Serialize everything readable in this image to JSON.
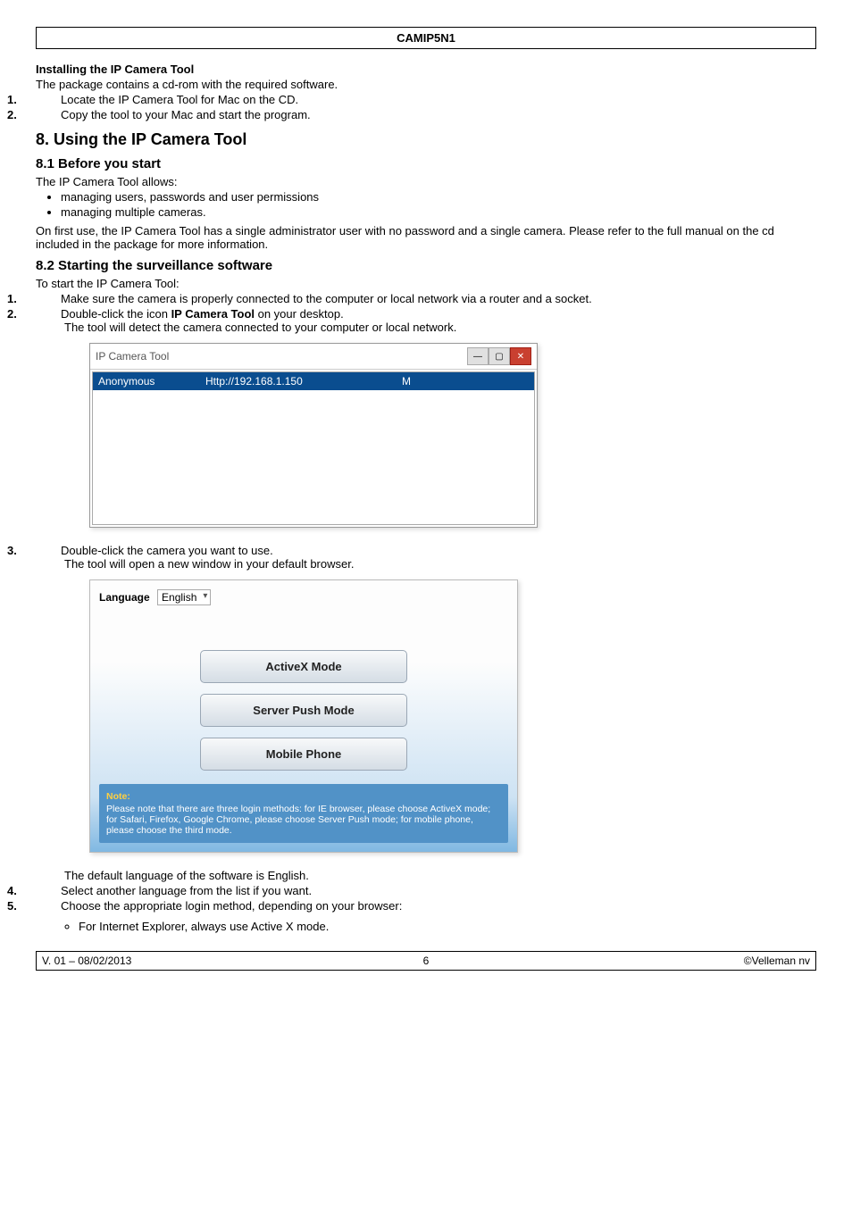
{
  "doc_header": "CAMIP5N1",
  "install": {
    "heading": "Installing the IP Camera Tool",
    "intro": "The package contains a cd-rom with the required software.",
    "steps": [
      "Locate the IP Camera Tool for Mac on the CD.",
      "Copy the tool to your Mac and start the program."
    ]
  },
  "section8": {
    "heading": "8.    Using the IP Camera Tool"
  },
  "section8_1": {
    "heading": "8.1    Before you start",
    "intro": "The IP Camera Tool allows:",
    "bullets": [
      "managing users, passwords and user permissions",
      "managing multiple cameras."
    ],
    "post": "On first use, the IP Camera Tool has a single administrator user with no password and a single camera. Please refer to the full manual on the cd included in the package for more information."
  },
  "section8_2": {
    "heading": "8.2    Starting the surveillance software",
    "intro": "To start the IP Camera Tool:",
    "step1": "Make sure the camera is properly connected to the computer or local network via a router and a socket.",
    "step2_a": "Double-click the icon ",
    "step2_bold": "IP Camera Tool",
    "step2_b": " on your desktop.",
    "step2_sub": "The tool will detect the camera connected to your computer or local network.",
    "ip_window": {
      "title": "IP Camera Tool",
      "row_label": "Anonymous",
      "row_url": "Http://192.168.1.150",
      "row_flag": "M"
    },
    "step3": "Double-click the camera you want to use.",
    "step3_sub": "The tool will open a new window in your default browser.",
    "login_window": {
      "lang_label": "Language",
      "lang_value": "English",
      "btn_activex": "ActiveX Mode",
      "btn_server": "Server Push Mode",
      "btn_mobile": "Mobile Phone",
      "note_title": "Note:",
      "note_body": "Please note that there are three login methods: for IE browser, please choose ActiveX mode; for Safari, Firefox, Google Chrome, please choose Server Push mode; for mobile phone, please choose the third mode."
    },
    "after_login": "The default language of the software is English.",
    "step4": "Select another language from the list if you want.",
    "step5": "Choose the appropriate login method, depending on your browser:",
    "step5_sub": "For Internet Explorer, always use Active X mode."
  },
  "footer": {
    "left": "V. 01 – 08/02/2013",
    "center": "6",
    "right": "©Velleman nv"
  }
}
